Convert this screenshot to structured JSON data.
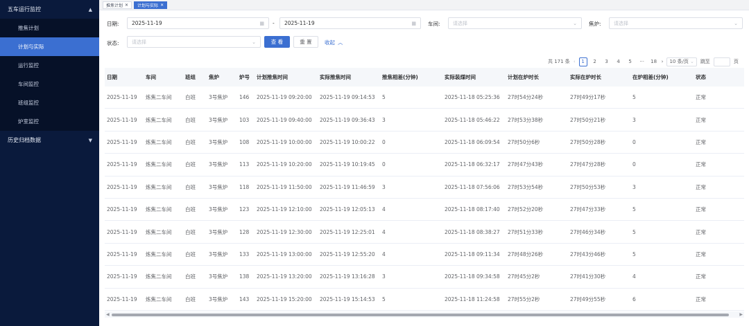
{
  "sidebar": {
    "group1": "五车运行监控",
    "items": [
      "推焦计划",
      "计划与实际",
      "运行监控",
      "车间监控",
      "班组监控",
      "炉室监控"
    ],
    "active_index": 1,
    "group2": "历史归档数据"
  },
  "tabs": [
    {
      "label": "推焦计划",
      "active": false
    },
    {
      "label": "计划与实际",
      "active": true
    }
  ],
  "filters": {
    "date_label": "日期:",
    "date_start": "2025-11-19",
    "date_sep": "-",
    "date_end": "2025-11-19",
    "workshop_label": "车间:",
    "workshop_placeholder": "请选择",
    "oven_label": "焦炉:",
    "oven_placeholder": "请选择",
    "status_label": "状态:",
    "status_placeholder": "请选择",
    "query_button": "查 看",
    "reset_button": "重 置",
    "collapse_label": "收起"
  },
  "pagination": {
    "total": "共 171 条",
    "pages": [
      "1",
      "2",
      "3",
      "4",
      "5",
      "···",
      "18"
    ],
    "current": "1",
    "page_size": "10 条/页",
    "jump_label": "跳至",
    "page_suffix": "页"
  },
  "table": {
    "columns": [
      "日期",
      "车间",
      "班组",
      "焦炉",
      "炉号",
      "计划推焦时间",
      "实际推焦时间",
      "推焦相差(分钟)",
      "实际装煤时间",
      "计划在炉时长",
      "实际在炉时长",
      "在炉相差(分钟)",
      "状态"
    ],
    "rows": [
      [
        "2025-11-19",
        "炼焦二车间",
        "白班",
        "3号焦炉",
        "146",
        "2025-11-19 09:20:00",
        "2025-11-19 09:14:53",
        "5",
        "2025-11-18 05:25:36",
        "27时54分24秒",
        "27时49分17秒",
        "5",
        "正常"
      ],
      [
        "2025-11-19",
        "炼焦二车间",
        "白班",
        "3号焦炉",
        "103",
        "2025-11-19 09:40:00",
        "2025-11-19 09:36:43",
        "3",
        "2025-11-18 05:46:22",
        "27时53分38秒",
        "27时50分21秒",
        "3",
        "正常"
      ],
      [
        "2025-11-19",
        "炼焦二车间",
        "白班",
        "3号焦炉",
        "108",
        "2025-11-19 10:00:00",
        "2025-11-19 10:00:22",
        "0",
        "2025-11-18 06:09:54",
        "27时50分6秒",
        "27时50分28秒",
        "0",
        "正常"
      ],
      [
        "2025-11-19",
        "炼焦二车间",
        "白班",
        "3号焦炉",
        "113",
        "2025-11-19 10:20:00",
        "2025-11-19 10:19:45",
        "0",
        "2025-11-18 06:32:17",
        "27时47分43秒",
        "27时47分28秒",
        "0",
        "正常"
      ],
      [
        "2025-11-19",
        "炼焦二车间",
        "白班",
        "3号焦炉",
        "118",
        "2025-11-19 11:50:00",
        "2025-11-19 11:46:59",
        "3",
        "2025-11-18 07:56:06",
        "27时53分54秒",
        "27时50分53秒",
        "3",
        "正常"
      ],
      [
        "2025-11-19",
        "炼焦二车间",
        "白班",
        "3号焦炉",
        "123",
        "2025-11-19 12:10:00",
        "2025-11-19 12:05:13",
        "4",
        "2025-11-18 08:17:40",
        "27时52分20秒",
        "27时47分33秒",
        "5",
        "正常"
      ],
      [
        "2025-11-19",
        "炼焦二车间",
        "白班",
        "3号焦炉",
        "128",
        "2025-11-19 12:30:00",
        "2025-11-19 12:25:01",
        "4",
        "2025-11-18 08:38:27",
        "27时51分33秒",
        "27时46分34秒",
        "5",
        "正常"
      ],
      [
        "2025-11-19",
        "炼焦二车间",
        "白班",
        "3号焦炉",
        "133",
        "2025-11-19 13:00:00",
        "2025-11-19 12:55:20",
        "4",
        "2025-11-18 09:11:34",
        "27时48分26秒",
        "27时43分46秒",
        "5",
        "正常"
      ],
      [
        "2025-11-19",
        "炼焦二车间",
        "白班",
        "3号焦炉",
        "138",
        "2025-11-19 13:20:00",
        "2025-11-19 13:16:28",
        "3",
        "2025-11-18 09:34:58",
        "27时45分2秒",
        "27时41分30秒",
        "4",
        "正常"
      ],
      [
        "2025-11-19",
        "炼焦二车间",
        "白班",
        "3号焦炉",
        "143",
        "2025-11-19 15:20:00",
        "2025-11-19 15:14:53",
        "5",
        "2025-11-18 11:24:58",
        "27时55分2秒",
        "27时49分55秒",
        "6",
        "正常"
      ]
    ]
  },
  "colors": {
    "sidebar_bg": "#0a1a3c",
    "accent": "#3b6fd1"
  }
}
